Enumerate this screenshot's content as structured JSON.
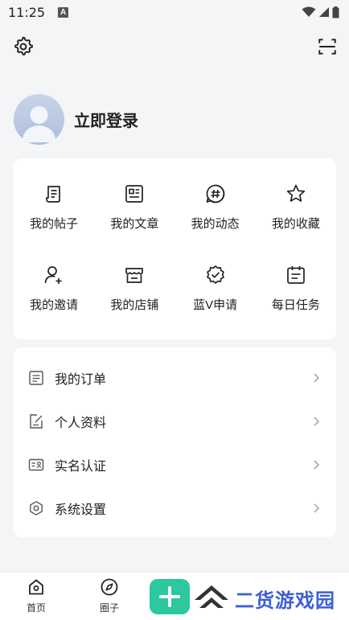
{
  "status_bar": {
    "time": "11:25",
    "badge": "A"
  },
  "profile": {
    "login_label": "立即登录"
  },
  "grid": {
    "items": [
      {
        "label": "我的帖子",
        "icon": "post-icon"
      },
      {
        "label": "我的文章",
        "icon": "article-icon"
      },
      {
        "label": "我的动态",
        "icon": "hashtag-icon"
      },
      {
        "label": "我的收藏",
        "icon": "star-icon"
      },
      {
        "label": "我的邀请",
        "icon": "invite-user-icon"
      },
      {
        "label": "我的店铺",
        "icon": "store-icon"
      },
      {
        "label": "蓝V申请",
        "icon": "verified-badge-icon"
      },
      {
        "label": "每日任务",
        "icon": "calendar-task-icon"
      }
    ]
  },
  "list": {
    "items": [
      {
        "label": "我的订单",
        "icon": "order-icon"
      },
      {
        "label": "个人资料",
        "icon": "edit-profile-icon"
      },
      {
        "label": "实名认证",
        "icon": "id-card-icon"
      },
      {
        "label": "系统设置",
        "icon": "hexagon-settings-icon"
      }
    ]
  },
  "bottom_nav": {
    "home_label": "首页",
    "circle_label": "圈子"
  },
  "watermark": {
    "text": "二货游戏园"
  },
  "colors": {
    "accent": "#2dc7a0",
    "watermark": "#3b5fd6",
    "background": "#f4f5f7"
  }
}
